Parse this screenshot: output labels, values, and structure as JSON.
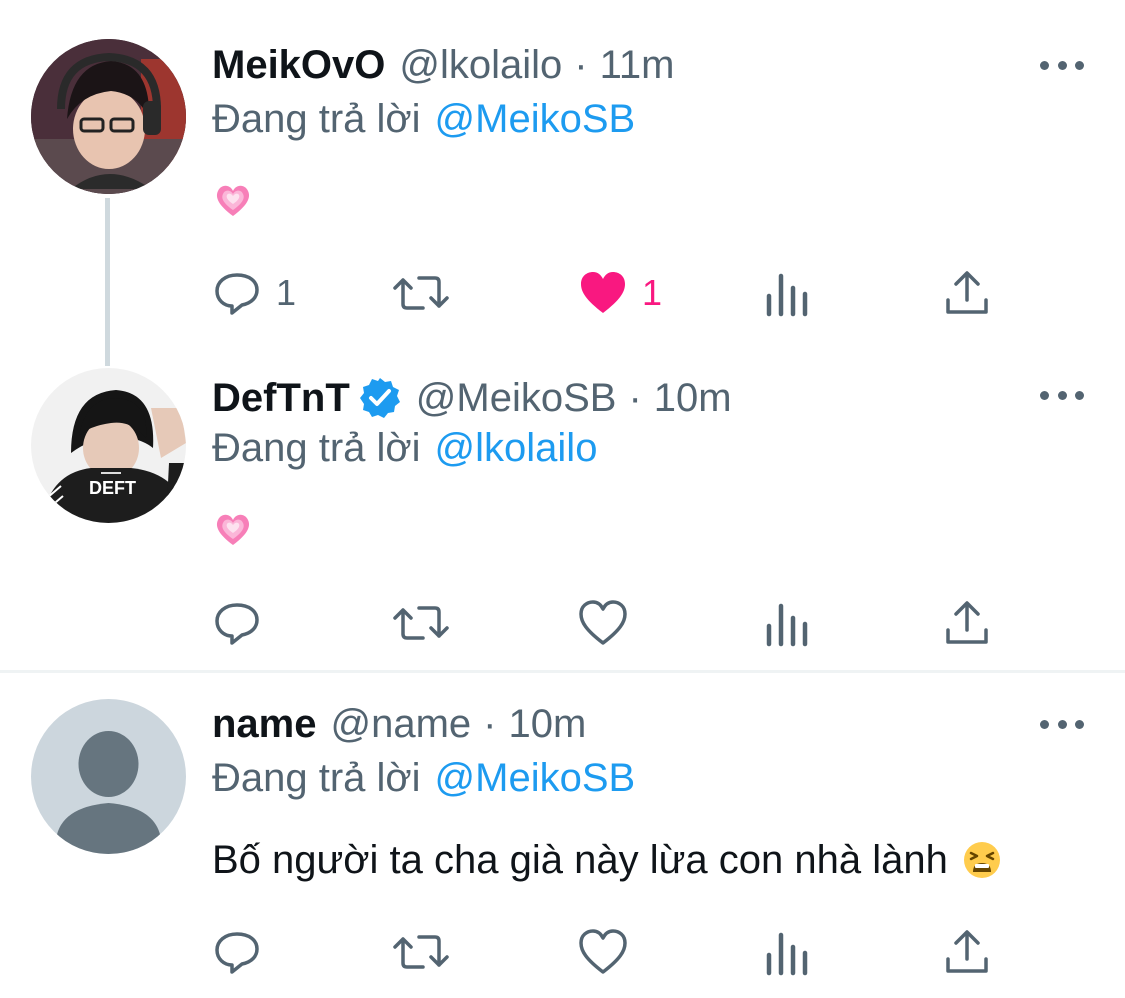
{
  "tweets": [
    {
      "display_name": "MeikOvO",
      "handle": "@lkolailo",
      "separator": "·",
      "time": "11m",
      "reply_prefix": "Đang trả lời",
      "reply_to": "@MeikoSB",
      "body_emoji": "sparkling-heart",
      "actions": {
        "replies": "1",
        "retweets": "",
        "likes": "1",
        "liked": true
      },
      "avatar_icon": "profile-photo"
    },
    {
      "display_name": "DefTnT",
      "verified": true,
      "handle": "@MeikoSB",
      "separator": "·",
      "time": "10m",
      "reply_prefix": "Đang trả lời",
      "reply_to": "@lkolailo",
      "body_emoji": "sparkling-heart",
      "jersey_text": "DEFT",
      "actions": {
        "replies": "",
        "retweets": "",
        "likes": "",
        "liked": false
      },
      "avatar_icon": "profile-photo"
    },
    {
      "display_name": "name",
      "handle": "@name",
      "separator": "·",
      "time": "10m",
      "reply_prefix": "Đang trả lời",
      "reply_to": "@MeikoSB",
      "body_text": "Bố người ta cha già này lừa con nhà lành",
      "body_emoji": "tired-face",
      "actions": {
        "replies": "",
        "retweets": "",
        "likes": "",
        "liked": false
      },
      "avatar_icon": "default-avatar"
    }
  ],
  "colors": {
    "text": "#0f1419",
    "secondary": "#536471",
    "link": "#1d9bf0",
    "like": "#f91880",
    "verified": "#1d9bf0",
    "thread_line": "#cfd9de"
  }
}
